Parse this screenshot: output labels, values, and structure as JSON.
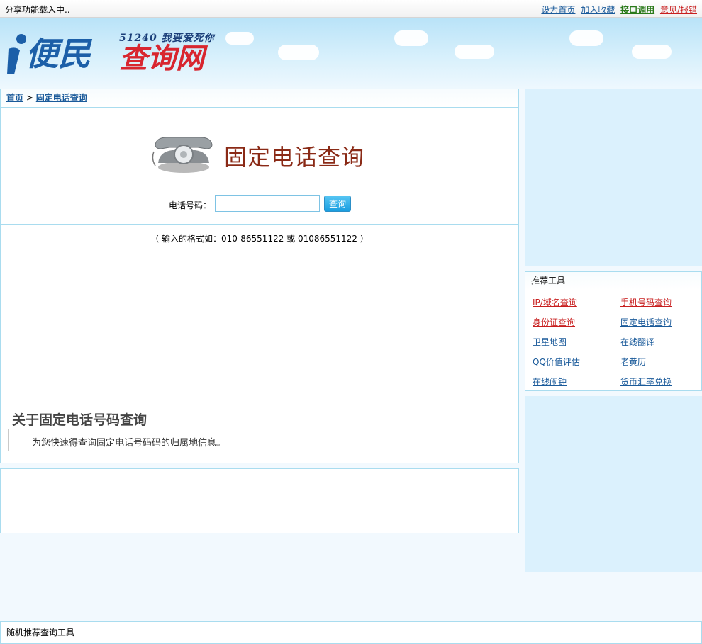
{
  "topbar": {
    "share_text": "分享功能载入中..",
    "links": {
      "set_home": "设为首页",
      "bookmark": "加入收藏",
      "api": "接口调用",
      "feedback": "意见/报错"
    }
  },
  "logo": {
    "slogan": "51240 我要爱死你",
    "word1": "便民",
    "word2": "查询网"
  },
  "breadcrumb": {
    "home": "首页",
    "separator": ">",
    "current": "固定电话查询"
  },
  "main": {
    "page_title": "固定电话查询",
    "field_label": "电话号码：",
    "input_value": "",
    "button_label": "查询",
    "format_hint": "（ 输入的格式如：010-86551122 或 01086551122 ）",
    "about_heading": "关于固定电话号码查询",
    "about_text": "为您快速得查询固定电话号码码的归属地信息。"
  },
  "tools": {
    "heading": "推荐工具",
    "items": [
      {
        "label": "IP/域名查询",
        "color": "#c81e1e"
      },
      {
        "label": "手机号码查询",
        "color": "#c81e1e"
      },
      {
        "label": "身份证查询",
        "color": "#c81e1e"
      },
      {
        "label": "固定电话查询",
        "color": "#1a5a9a"
      },
      {
        "label": "卫星地图",
        "color": "#1a5a9a"
      },
      {
        "label": "在线翻译",
        "color": "#1a5a9a"
      },
      {
        "label": "QQ价值评估",
        "color": "#1a5a9a"
      },
      {
        "label": "老黄历",
        "color": "#1a5a9a"
      },
      {
        "label": "在线闹钟",
        "color": "#1a5a9a"
      },
      {
        "label": "货币汇率兑换",
        "color": "#1a5a9a"
      }
    ]
  },
  "random_tools": {
    "heading": "随机推荐查询工具"
  },
  "colors": {
    "accent_blue": "#1a5a9a",
    "accent_red": "#c81e1e",
    "border": "#a9dcef",
    "sidebar_bg": "#dbf1fd"
  }
}
